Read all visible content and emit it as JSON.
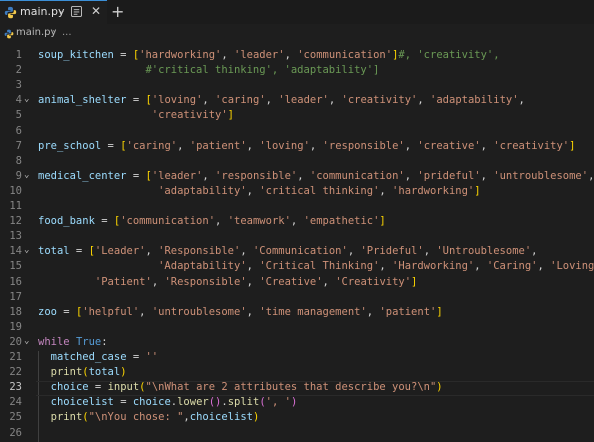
{
  "tab": {
    "filename": "main.py",
    "chevron": "⌄",
    "close": "✕",
    "new_tab": "+"
  },
  "breadcrumb": {
    "file": "main.py",
    "separator": "›",
    "more": "..."
  },
  "editor": {
    "active_line": 23,
    "lines": [
      {
        "n": "1",
        "fold": "",
        "tokens": [
          [
            "v",
            "soup_kitchen"
          ],
          [
            "p",
            " = "
          ],
          [
            "b",
            "["
          ],
          [
            "s",
            "'hardworking'"
          ],
          [
            "p",
            ", "
          ],
          [
            "s",
            "'leader'"
          ],
          [
            "p",
            ", "
          ],
          [
            "s",
            "'communication'"
          ],
          [
            "b",
            "]"
          ],
          [
            "c",
            "#, 'creativity',"
          ]
        ]
      },
      {
        "n": "2",
        "fold": "",
        "tokens": [
          [
            "c",
            "                 #'critical thinking', 'adaptability']"
          ]
        ]
      },
      {
        "n": "3",
        "fold": "",
        "tokens": []
      },
      {
        "n": "4",
        "fold": "⌄",
        "tokens": [
          [
            "v",
            "animal_shelter"
          ],
          [
            "p",
            " = "
          ],
          [
            "b",
            "["
          ],
          [
            "s",
            "'loving'"
          ],
          [
            "p",
            ", "
          ],
          [
            "s",
            "'caring'"
          ],
          [
            "p",
            ", "
          ],
          [
            "s",
            "'leader'"
          ],
          [
            "p",
            ", "
          ],
          [
            "s",
            "'creativity'"
          ],
          [
            "p",
            ", "
          ],
          [
            "s",
            "'adaptability'"
          ],
          [
            "p",
            ","
          ]
        ]
      },
      {
        "n": "5",
        "fold": "",
        "tokens": [
          [
            "p",
            "                  "
          ],
          [
            "s",
            "'creativity'"
          ],
          [
            "b",
            "]"
          ]
        ]
      },
      {
        "n": "6",
        "fold": "",
        "tokens": []
      },
      {
        "n": "7",
        "fold": "",
        "tokens": [
          [
            "v",
            "pre_school"
          ],
          [
            "p",
            " = "
          ],
          [
            "b",
            "["
          ],
          [
            "s",
            "'caring'"
          ],
          [
            "p",
            ", "
          ],
          [
            "s",
            "'patient'"
          ],
          [
            "p",
            ", "
          ],
          [
            "s",
            "'loving'"
          ],
          [
            "p",
            ", "
          ],
          [
            "s",
            "'responsible'"
          ],
          [
            "p",
            ", "
          ],
          [
            "s",
            "'creative'"
          ],
          [
            "p",
            ", "
          ],
          [
            "s",
            "'creativity'"
          ],
          [
            "b",
            "]"
          ]
        ]
      },
      {
        "n": "8",
        "fold": "",
        "tokens": []
      },
      {
        "n": "9",
        "fold": "⌄",
        "tokens": [
          [
            "v",
            "medical_center"
          ],
          [
            "p",
            " = "
          ],
          [
            "b",
            "["
          ],
          [
            "s",
            "'leader'"
          ],
          [
            "p",
            ", "
          ],
          [
            "s",
            "'responsible'"
          ],
          [
            "p",
            ", "
          ],
          [
            "s",
            "'communication'"
          ],
          [
            "p",
            ", "
          ],
          [
            "s",
            "'prideful'"
          ],
          [
            "p",
            ", "
          ],
          [
            "s",
            "'untroublesome'"
          ],
          [
            "p",
            ","
          ]
        ]
      },
      {
        "n": "10",
        "fold": "",
        "tokens": [
          [
            "p",
            "                   "
          ],
          [
            "s",
            "'adaptability'"
          ],
          [
            "p",
            ", "
          ],
          [
            "s",
            "'critical thinking'"
          ],
          [
            "p",
            ", "
          ],
          [
            "s",
            "'hardworking'"
          ],
          [
            "b",
            "]"
          ]
        ]
      },
      {
        "n": "11",
        "fold": "",
        "tokens": []
      },
      {
        "n": "12",
        "fold": "",
        "tokens": [
          [
            "v",
            "food_bank"
          ],
          [
            "p",
            " = "
          ],
          [
            "b",
            "["
          ],
          [
            "s",
            "'communication'"
          ],
          [
            "p",
            ", "
          ],
          [
            "s",
            "'teamwork'"
          ],
          [
            "p",
            ", "
          ],
          [
            "s",
            "'empathetic'"
          ],
          [
            "b",
            "]"
          ]
        ]
      },
      {
        "n": "13",
        "fold": "",
        "tokens": []
      },
      {
        "n": "14",
        "fold": "⌄",
        "tokens": [
          [
            "v",
            "total"
          ],
          [
            "p",
            " = "
          ],
          [
            "b",
            "["
          ],
          [
            "s",
            "'Leader'"
          ],
          [
            "p",
            ", "
          ],
          [
            "s",
            "'Responsible'"
          ],
          [
            "p",
            ", "
          ],
          [
            "s",
            "'Communication'"
          ],
          [
            "p",
            ", "
          ],
          [
            "s",
            "'Prideful'"
          ],
          [
            "p",
            ", "
          ],
          [
            "s",
            "'Untroublesome'"
          ],
          [
            "p",
            ","
          ]
        ]
      },
      {
        "n": "15",
        "fold": "",
        "tokens": [
          [
            "p",
            "                   "
          ],
          [
            "s",
            "'Adaptability'"
          ],
          [
            "p",
            ", "
          ],
          [
            "s",
            "'Critical Thinking'"
          ],
          [
            "p",
            ", "
          ],
          [
            "s",
            "'Hardworking'"
          ],
          [
            "p",
            ", "
          ],
          [
            "s",
            "'Caring'"
          ],
          [
            "p",
            ", "
          ],
          [
            "s",
            "'Loving'"
          ],
          [
            "p",
            ","
          ]
        ]
      },
      {
        "n": "16",
        "fold": "",
        "tokens": [
          [
            "p",
            "         "
          ],
          [
            "s",
            "'Patient'"
          ],
          [
            "p",
            ", "
          ],
          [
            "s",
            "'Responsible'"
          ],
          [
            "p",
            ", "
          ],
          [
            "s",
            "'Creative'"
          ],
          [
            "p",
            ", "
          ],
          [
            "s",
            "'Creativity'"
          ],
          [
            "b",
            "]"
          ]
        ]
      },
      {
        "n": "17",
        "fold": "",
        "tokens": []
      },
      {
        "n": "18",
        "fold": "",
        "tokens": [
          [
            "v",
            "zoo"
          ],
          [
            "p",
            " = "
          ],
          [
            "b",
            "["
          ],
          [
            "s",
            "'helpful'"
          ],
          [
            "p",
            ", "
          ],
          [
            "s",
            "'untroublesome'"
          ],
          [
            "p",
            ", "
          ],
          [
            "s",
            "'time management'"
          ],
          [
            "p",
            ", "
          ],
          [
            "s",
            "'patient'"
          ],
          [
            "b",
            "]"
          ]
        ]
      },
      {
        "n": "19",
        "fold": "",
        "tokens": []
      },
      {
        "n": "20",
        "fold": "⌄",
        "tokens": [
          [
            "kw",
            "while"
          ],
          [
            "p",
            " "
          ],
          [
            "k",
            "True"
          ],
          [
            "p",
            ":"
          ]
        ]
      },
      {
        "n": "21",
        "fold": "",
        "tokens": [
          [
            "p",
            "  "
          ],
          [
            "v",
            "matched_case"
          ],
          [
            "p",
            " = "
          ],
          [
            "s",
            "''"
          ]
        ]
      },
      {
        "n": "22",
        "fold": "",
        "tokens": [
          [
            "p",
            "  "
          ],
          [
            "f",
            "print"
          ],
          [
            "b",
            "("
          ],
          [
            "v",
            "total"
          ],
          [
            "b",
            ")"
          ]
        ]
      },
      {
        "n": "23",
        "fold": "",
        "tokens": [
          [
            "p",
            "  "
          ],
          [
            "v",
            "choice"
          ],
          [
            "p",
            " = "
          ],
          [
            "f",
            "input"
          ],
          [
            "b",
            "("
          ],
          [
            "s",
            "\"\\nWhat are 2 attributes that describe you?\\n\""
          ],
          [
            "b",
            ")"
          ]
        ]
      },
      {
        "n": "24",
        "fold": "",
        "tokens": [
          [
            "p",
            "  "
          ],
          [
            "v",
            "choicelist"
          ],
          [
            "p",
            " = "
          ],
          [
            "v",
            "choice"
          ],
          [
            "p",
            "."
          ],
          [
            "f",
            "lower"
          ],
          [
            "b2",
            "()"
          ],
          [
            "p",
            "."
          ],
          [
            "f",
            "split"
          ],
          [
            "b2",
            "("
          ],
          [
            "s",
            "', '"
          ],
          [
            "b2",
            ")"
          ]
        ]
      },
      {
        "n": "25",
        "fold": "",
        "tokens": [
          [
            "p",
            "  "
          ],
          [
            "f",
            "print"
          ],
          [
            "b",
            "("
          ],
          [
            "s",
            "\"\\nYou chose: \""
          ],
          [
            "p",
            ","
          ],
          [
            "v",
            "choicelist"
          ],
          [
            "b",
            ")"
          ]
        ]
      },
      {
        "n": "26",
        "fold": "",
        "tokens": []
      }
    ]
  }
}
